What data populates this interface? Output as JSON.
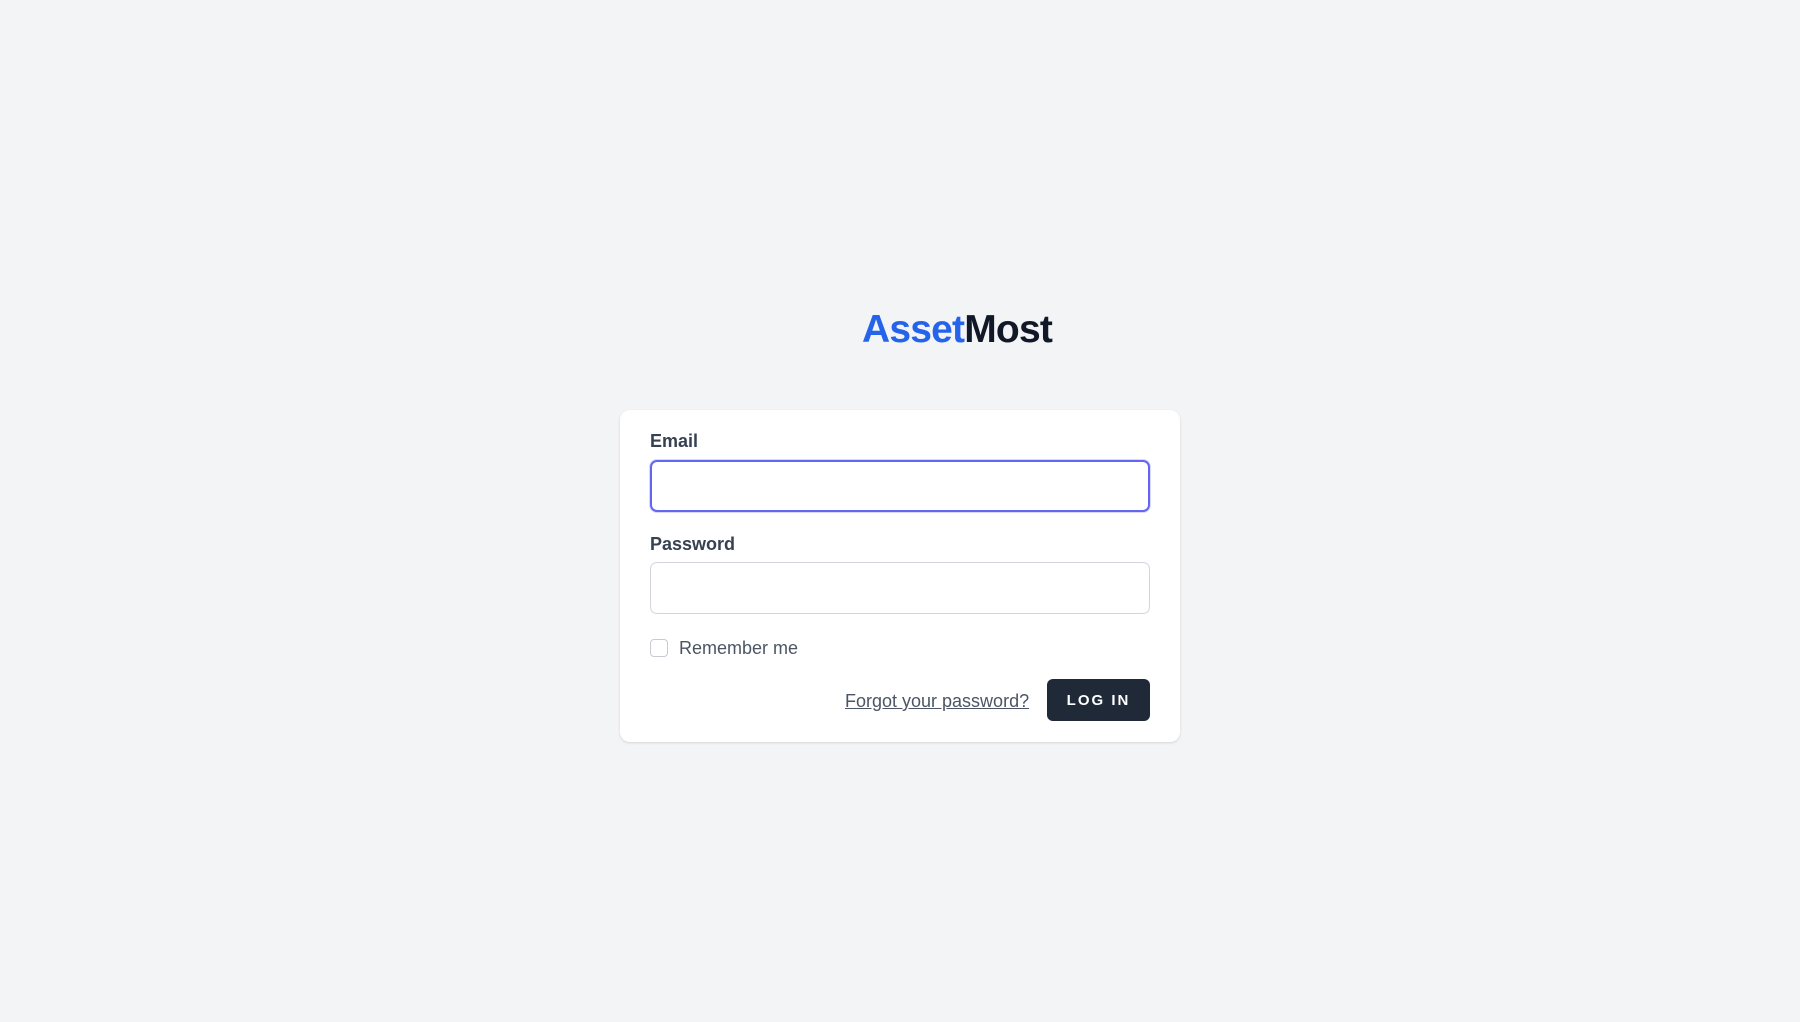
{
  "brand": {
    "name_part_a": "Asset",
    "name_part_b": "Most",
    "color_a": "#2563eb",
    "color_b": "#111827"
  },
  "login_form": {
    "email_label": "Email",
    "email_value": "",
    "password_label": "Password",
    "password_value": "",
    "remember_label": "Remember me",
    "remember_checked": false,
    "forgot_link": "Forgot your password?",
    "submit_label": "LOG IN"
  },
  "colors": {
    "background": "#f3f4f6",
    "focus_ring": "#6366f1",
    "button": "#1f2937"
  }
}
